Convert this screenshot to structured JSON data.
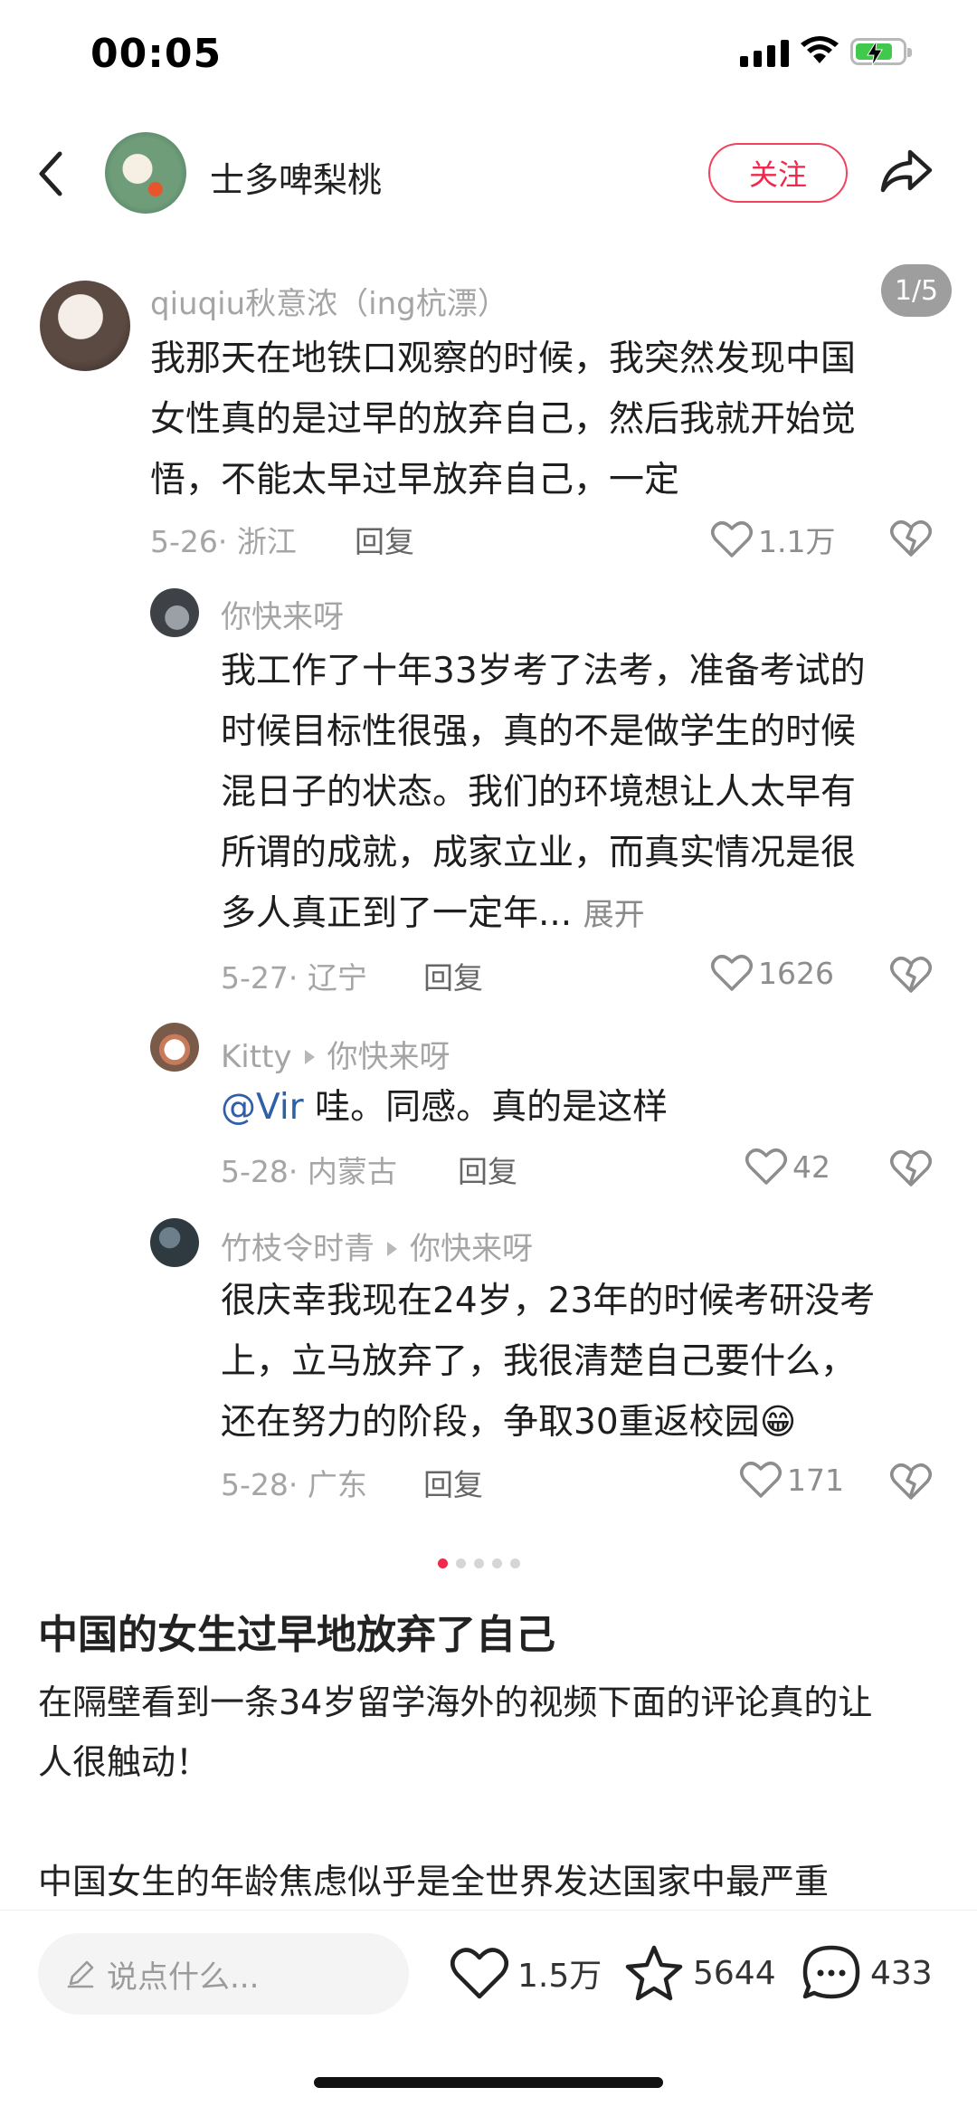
{
  "status_bar": {
    "time": "00:05"
  },
  "header": {
    "author_name": "士多啤梨桃",
    "follow_label": "关注"
  },
  "image_counter": "1/5",
  "comments": [
    {
      "name": "qiuqiu秋意浓（ing杭漂）",
      "text_lines": [
        "我那天在地铁口观察的时候，我突然发现中国",
        "女性真的是过早的放弃自己，然后我就开始觉",
        "悟，不能太早过早放弃自己，一定"
      ],
      "date_loc": "5-26· 浙江",
      "reply_label": "回复",
      "likes": "1.1万"
    },
    {
      "name": "你快来呀",
      "text_lines": [
        "我工作了十年33岁考了法考，准备考试的",
        "时候目标性很强，真的不是做学生的时候",
        "混日子的状态。我们的环境想让人太早有",
        "所谓的成就，成家立业，而真实情况是很"
      ],
      "last_line": "多人真正到了一定年...",
      "expand_label": "展开",
      "date_loc": "5-27· 辽宁",
      "reply_label": "回复",
      "likes": "1626"
    },
    {
      "name": "Kitty",
      "reply_to": "你快来呀",
      "mention": "@Vir",
      "text": " 哇。同感。真的是这样",
      "date_loc": "5-28· 内蒙古",
      "reply_label": "回复",
      "likes": "42"
    },
    {
      "name": "竹枝令时青",
      "reply_to": "你快来呀",
      "text_lines": [
        "很庆幸我现在24岁，23年的时候考研没考",
        "上，立马放弃了，我很清楚自己要什么，",
        "还在努力的阶段，争取30重返校园😁"
      ],
      "date_loc": "5-28· 广东",
      "reply_label": "回复",
      "likes": "171"
    }
  ],
  "post": {
    "title": "中国的女生过早地放弃了自己",
    "body_lines": [
      "在隔壁看到一条34岁留学海外的视频下面的评论真的让",
      "人很触动！",
      "",
      "中国女生的年龄焦虑似乎是全世界发达国家中最严重"
    ]
  },
  "bottom_bar": {
    "input_placeholder": "说点什么...",
    "likes": "1.5万",
    "collects": "5644",
    "comments": "433"
  },
  "colors": {
    "accent": "#f0284c",
    "meta_gray": "#a5a5a5",
    "link_blue": "#2f5fa8"
  },
  "icons": [
    "back-icon",
    "share-icon",
    "heart-icon",
    "dislike-icon",
    "pencil-icon",
    "star-icon",
    "comment-icon"
  ]
}
